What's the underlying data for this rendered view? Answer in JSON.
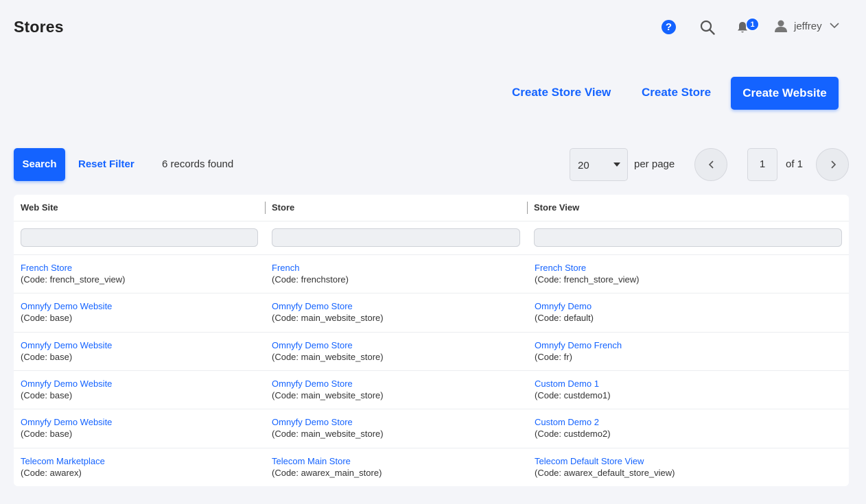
{
  "page": {
    "title": "Stores"
  },
  "header": {
    "help_icon": "question-circle-icon",
    "search_icon": "search-icon",
    "notifications_icon": "bell-icon",
    "notifications_count": "1",
    "user_icon": "user-icon",
    "user_name": "jeffrey",
    "chevron_icon": "chevron-down-icon"
  },
  "actions": {
    "create_store_view": "Create Store View",
    "create_store": "Create Store",
    "create_website": "Create Website"
  },
  "toolbar": {
    "search_label": "Search",
    "reset_filter_label": "Reset Filter",
    "records_found": "6 records found",
    "per_page_value": "20",
    "per_page_label": "per page",
    "current_page": "1",
    "of_pages": "of 1"
  },
  "colors": {
    "accent": "#1463ff",
    "background": "#f4f5f9"
  },
  "grid": {
    "columns": [
      "Web Site",
      "Store",
      "Store View"
    ],
    "rows": [
      {
        "website": "French Store",
        "website_code": "(Code: french_store_view)",
        "store": "French",
        "store_code": "(Code: frenchstore)",
        "store_view": "French Store",
        "store_view_code": "(Code: french_store_view)"
      },
      {
        "website": "Omnyfy Demo Website",
        "website_code": "(Code: base)",
        "store": "Omnyfy Demo Store",
        "store_code": "(Code: main_website_store)",
        "store_view": "Omnyfy Demo",
        "store_view_code": "(Code: default)"
      },
      {
        "website": "Omnyfy Demo Website",
        "website_code": "(Code: base)",
        "store": "Omnyfy Demo Store",
        "store_code": "(Code: main_website_store)",
        "store_view": "Omnyfy Demo French",
        "store_view_code": "(Code: fr)"
      },
      {
        "website": "Omnyfy Demo Website",
        "website_code": "(Code: base)",
        "store": "Omnyfy Demo Store",
        "store_code": "(Code: main_website_store)",
        "store_view": "Custom Demo 1",
        "store_view_code": "(Code: custdemo1)"
      },
      {
        "website": "Omnyfy Demo Website",
        "website_code": "(Code: base)",
        "store": "Omnyfy Demo Store",
        "store_code": "(Code: main_website_store)",
        "store_view": "Custom Demo 2",
        "store_view_code": "(Code: custdemo2)"
      },
      {
        "website": "Telecom Marketplace",
        "website_code": "(Code: awarex)",
        "store": "Telecom Main Store",
        "store_code": "(Code: awarex_main_store)",
        "store_view": "Telecom Default Store View",
        "store_view_code": "(Code: awarex_default_store_view)"
      }
    ]
  }
}
